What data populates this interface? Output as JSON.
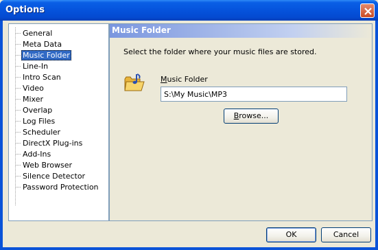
{
  "window": {
    "title": "Options"
  },
  "tree": {
    "items": [
      "General",
      "Meta Data",
      "Music Folder",
      "Line-In",
      "Intro Scan",
      "Video",
      "Mixer",
      "Overlap",
      "Log Files",
      "Scheduler",
      "DirectX Plug-ins",
      "Add-Ins",
      "Web Browser",
      "Silence Detector",
      "Password Protection"
    ],
    "selected": "Music Folder"
  },
  "panel": {
    "title": "Music Folder",
    "description": "Select the folder where your music files are stored.",
    "field_label_accel": "M",
    "field_label_rest": "usic Folder",
    "path_value": "S:\\My Music\\MP3",
    "browse_accel": "B",
    "browse_rest": "rowse..."
  },
  "buttons": {
    "ok": "OK",
    "cancel": "Cancel"
  }
}
